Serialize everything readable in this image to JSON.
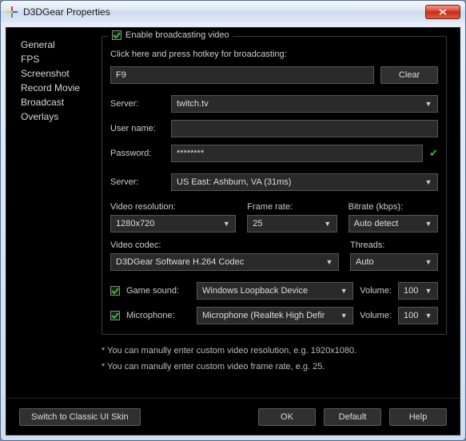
{
  "window": {
    "title": "D3DGear Properties"
  },
  "sidebar": {
    "items": [
      {
        "label": "General"
      },
      {
        "label": "FPS"
      },
      {
        "label": "Screenshot"
      },
      {
        "label": "Record Movie"
      },
      {
        "label": "Broadcast"
      },
      {
        "label": "Overlays"
      }
    ]
  },
  "main": {
    "enable_label": "Enable broadcasting video",
    "hotkey_hint": "Click here and press hotkey for broadcasting:",
    "hotkey_value": "F9",
    "clear": "Clear",
    "server_label": "Server:",
    "server_value": "twitch.tv",
    "user_label": "User name:",
    "user_value": "",
    "pw_label": "Password:",
    "pw_value": "********",
    "region_label": "Server:",
    "region_value": "US East: Ashburn, VA    (31ms)",
    "res_label": "Video resolution:",
    "res_value": "1280x720",
    "frate_label": "Frame rate:",
    "frate_value": "25",
    "bitrate_label": "Bitrate (kbps):",
    "bitrate_value": "Auto detect",
    "codec_label": "Video codec:",
    "codec_value": "D3DGear Software H.264 Codec",
    "threads_label": "Threads:",
    "threads_value": "Auto",
    "gamesound_label": "Game sound:",
    "gamesound_value": "Windows Loopback Device",
    "mic_label": "Microphone:",
    "mic_value": "Microphone (Realtek High Defir",
    "volume_label": "Volume:",
    "volume1": "100",
    "volume2": "100",
    "hint1": "* You can manully enter custom video resolution, e.g. 1920x1080.",
    "hint2": "* You can manully enter custom video frame rate, e.g. 25."
  },
  "footer": {
    "classic": "Switch to Classic UI Skin",
    "ok": "OK",
    "def": "Default",
    "help": "Help"
  }
}
